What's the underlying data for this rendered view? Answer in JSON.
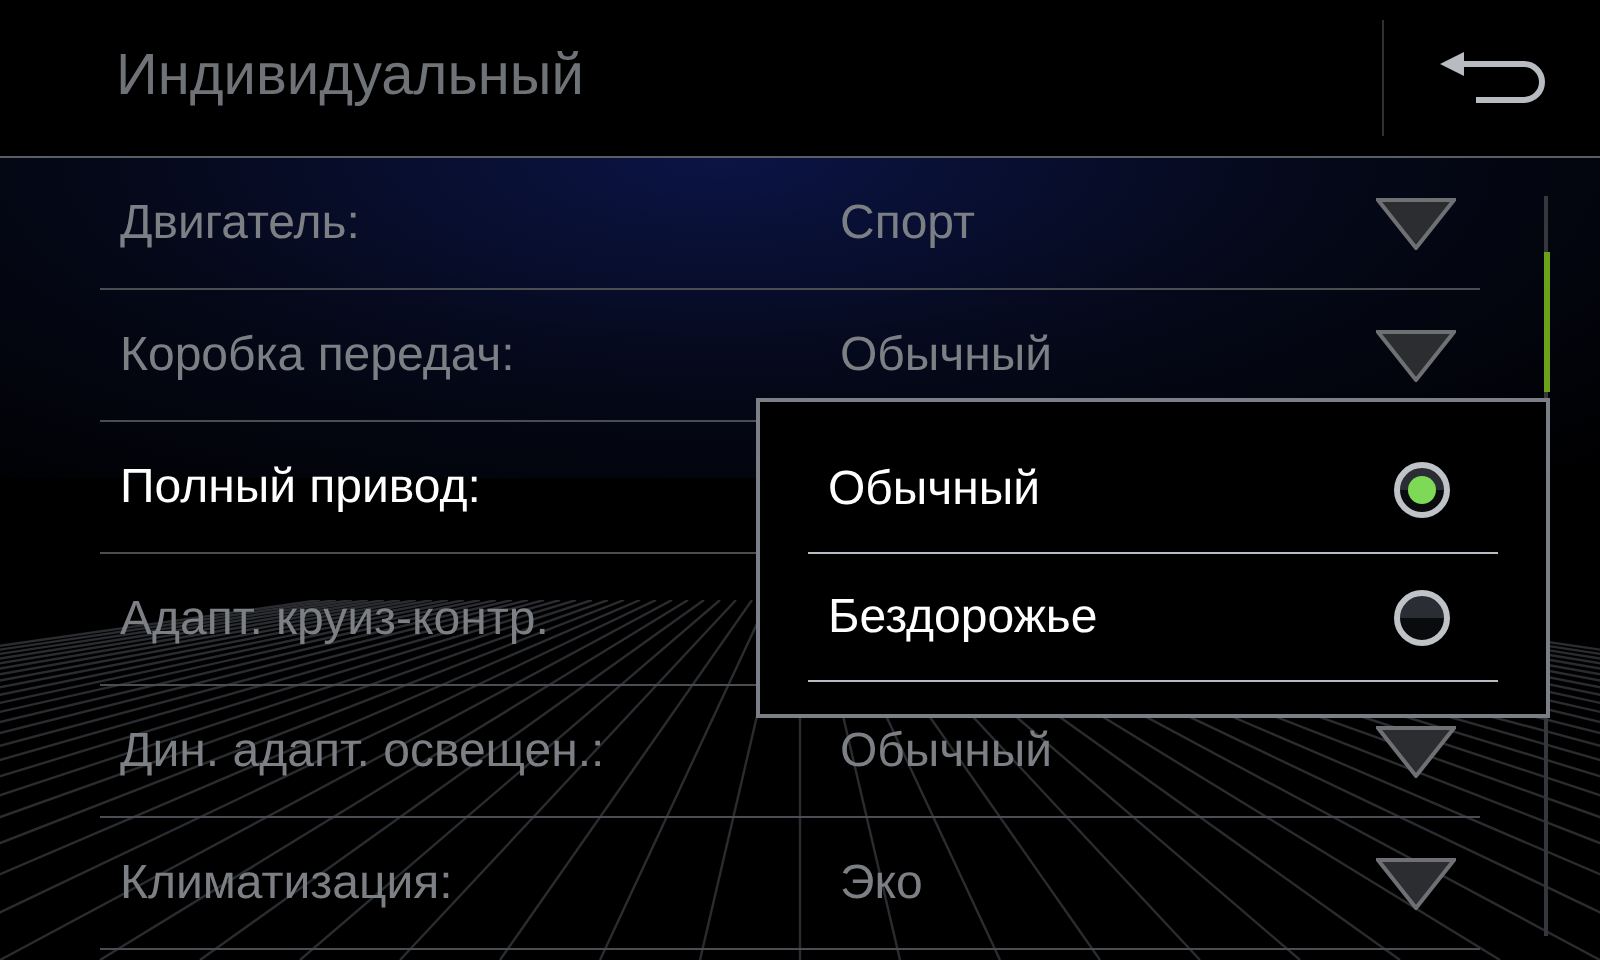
{
  "header": {
    "title": "Индивидуальный"
  },
  "settings": [
    {
      "label": "Двигатель:",
      "value": "Спорт",
      "active": false
    },
    {
      "label": "Коробка передач:",
      "value": "Обычный",
      "active": false
    },
    {
      "label": "Полный привод:",
      "active": true
    },
    {
      "label": "Адапт. круиз-контр.",
      "active": false
    },
    {
      "label": "Дин. адапт. освещен.:",
      "value": "Обычный",
      "active": false
    },
    {
      "label": "Климатизация:",
      "value": "Эко",
      "active": false
    }
  ],
  "popup": {
    "options": [
      {
        "label": "Обычный",
        "selected": true
      },
      {
        "label": "Бездорожье",
        "selected": false
      }
    ]
  }
}
